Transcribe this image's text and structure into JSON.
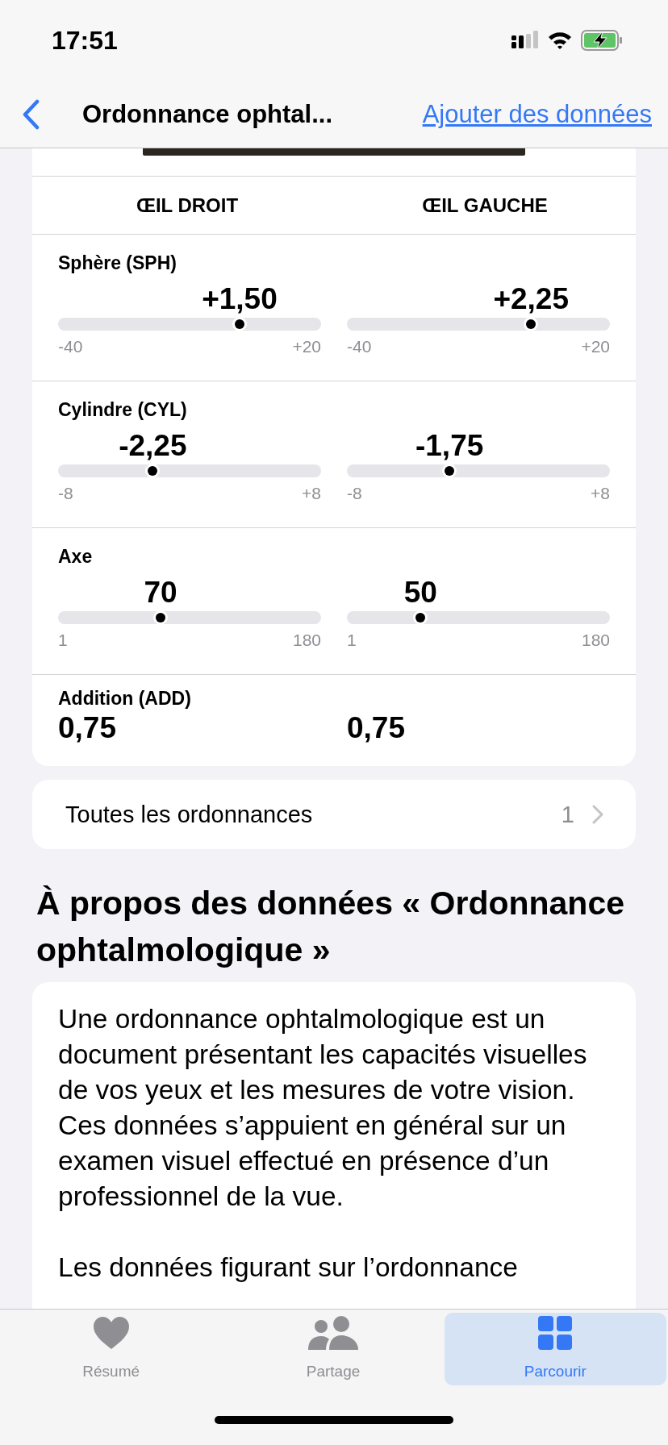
{
  "status_bar": {
    "time": "17:51"
  },
  "nav": {
    "title": "Ordonnance ophtal...",
    "action": "Ajouter des données"
  },
  "prescription": {
    "columns": [
      "ŒIL DROIT",
      "ŒIL GAUCHE"
    ],
    "rows": [
      {
        "kind": "slider",
        "label": "Sphère (SPH)",
        "eyes": [
          {
            "value": "+1,50",
            "min": "-40",
            "max": "+20",
            "level": 0.69
          },
          {
            "value": "+2,25",
            "min": "-40",
            "max": "+20",
            "level": 0.7
          }
        ]
      },
      {
        "kind": "slider",
        "label": "Cylindre (CYL)",
        "eyes": [
          {
            "value": "-2,25",
            "min": "-8",
            "max": "+8",
            "level": 0.36
          },
          {
            "value": "-1,75",
            "min": "-8",
            "max": "+8",
            "level": 0.39
          }
        ]
      },
      {
        "kind": "slider",
        "label": "Axe",
        "eyes": [
          {
            "value": "70",
            "min": "1",
            "max": "180",
            "level": 0.39
          },
          {
            "value": "50",
            "min": "1",
            "max": "180",
            "level": 0.28
          }
        ]
      },
      {
        "kind": "value",
        "label": "Addition (ADD)",
        "eyes": [
          {
            "value": "0,75"
          },
          {
            "value": "0,75"
          }
        ]
      }
    ]
  },
  "all_prescriptions": {
    "label": "Toutes les ordonnances",
    "count": "1"
  },
  "about": {
    "heading": "À propos des données « Ordonnance ophtalmologique »",
    "paragraphs": [
      "Une ordonnance ophtalmologique est un document présentant les capacités visuelles de vos yeux et les mesures de votre vision. Ces données s’appuient en général sur un examen visuel effectué en présence d’un professionnel de la vue.",
      "Les données figurant sur l’ordonnance"
    ]
  },
  "tabs": [
    {
      "label": "Résumé",
      "kind": "summary",
      "selected": false
    },
    {
      "label": "Partage",
      "kind": "sharing",
      "selected": false
    },
    {
      "label": "Parcourir",
      "kind": "browse",
      "selected": true
    }
  ]
}
